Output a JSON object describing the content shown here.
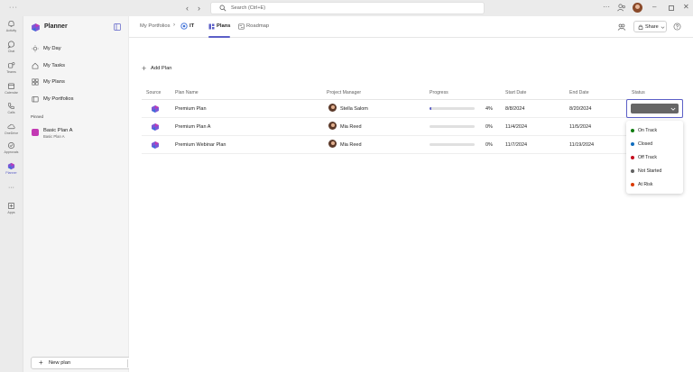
{
  "titlebar": {
    "search_placeholder": "Search (Ctrl+E)"
  },
  "rail": {
    "items": [
      {
        "label": "Activity",
        "icon": "bell-icon"
      },
      {
        "label": "Chat",
        "icon": "chat-icon"
      },
      {
        "label": "Teams",
        "icon": "teams-icon"
      },
      {
        "label": "Calendar",
        "icon": "calendar-icon"
      },
      {
        "label": "Calls",
        "icon": "phone-icon"
      },
      {
        "label": "OneDrive",
        "icon": "cloud-icon"
      },
      {
        "label": "Approvals",
        "icon": "approvals-icon"
      },
      {
        "label": "Planner",
        "icon": "planner-icon"
      },
      {
        "label": "Apps",
        "icon": "apps-icon"
      }
    ]
  },
  "sidebar": {
    "title": "Planner",
    "items": [
      {
        "label": "My Day",
        "icon": "sun-icon"
      },
      {
        "label": "My Tasks",
        "icon": "home-icon"
      },
      {
        "label": "My Plans",
        "icon": "grid-icon"
      },
      {
        "label": "My Portfolios",
        "icon": "folder-icon"
      }
    ],
    "pinned_label": "Pinned",
    "pinned_plan": {
      "title": "Basic Plan A",
      "subtitle": "Basic Plan A"
    },
    "new_plan_label": "New plan"
  },
  "header": {
    "breadcrumb_root": "My Portfolios",
    "breadcrumb_current": "IT",
    "tabs": [
      {
        "label": "Plans",
        "active": true
      },
      {
        "label": "Roadmap",
        "active": false
      }
    ],
    "share_label": "Share"
  },
  "main": {
    "add_plan_label": "Add Plan",
    "columns": [
      "Source",
      "Plan Name",
      "Project Manager",
      "Progress",
      "Start Date",
      "End Date",
      "Status"
    ],
    "rows": [
      {
        "plan": "Premium Plan",
        "manager": "Stella Salom",
        "progress": 4,
        "progress_label": "4%",
        "start": "8/8/2024",
        "end": "8/20/2024"
      },
      {
        "plan": "Premium Plan A",
        "manager": "Mia Reed",
        "progress": 0,
        "progress_label": "0%",
        "start": "11/4/2024",
        "end": "11/5/2024"
      },
      {
        "plan": "Premium Webinar Plan",
        "manager": "Mia Reed",
        "progress": 0,
        "progress_label": "0%",
        "start": "11/7/2024",
        "end": "11/19/2024"
      }
    ],
    "status_options": [
      {
        "label": "On Track",
        "color": "#107c10"
      },
      {
        "label": "Closed",
        "color": "#0f6cbd"
      },
      {
        "label": "Off Track",
        "color": "#c50f1f"
      },
      {
        "label": "Not Started",
        "color": "#616161"
      },
      {
        "label": "At Risk",
        "color": "#da3b01"
      }
    ]
  },
  "colors": {
    "accent": "#5b5fc7",
    "progress_track": "#e0e0e0"
  }
}
